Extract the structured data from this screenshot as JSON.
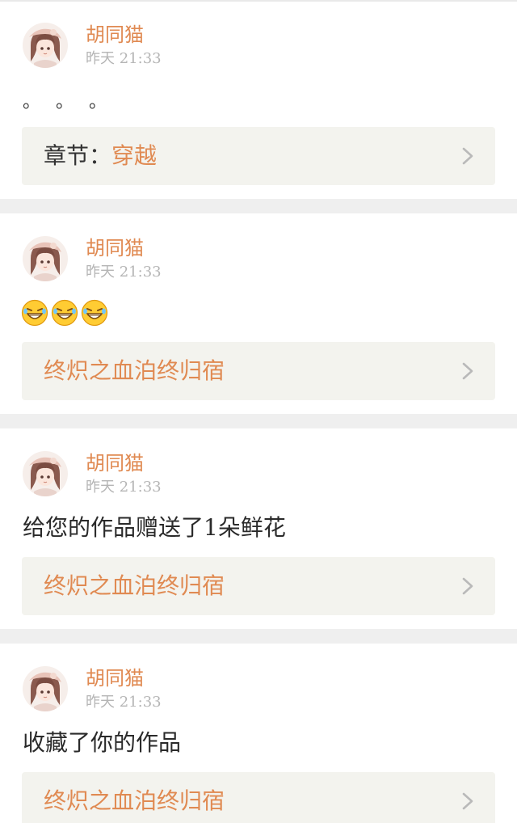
{
  "colors": {
    "accent": "#e08a52",
    "page_bg": "#efefef",
    "card_bg": "#ffffff",
    "link_box_bg": "#f3f3ee",
    "timestamp": "#b5b5b5",
    "body_text": "#2a2a2a"
  },
  "feed": [
    {
      "username": "胡同猫",
      "timestamp": "昨天 21:33",
      "content": "。 。 。",
      "link_prefix": "章节：",
      "link_value": "穿越",
      "avatar_icon": "anime-girl-avatar",
      "link_icon": "chevron-right-icon"
    },
    {
      "username": "胡同猫",
      "timestamp": "昨天 21:33",
      "emoji_icons": [
        "laughing-tears-emoji",
        "laughing-tears-emoji",
        "laughing-tears-emoji"
      ],
      "link_value": "终炽之血泊终归宿",
      "avatar_icon": "anime-girl-avatar",
      "link_icon": "chevron-right-icon"
    },
    {
      "username": "胡同猫",
      "timestamp": "昨天 21:33",
      "content": "给您的作品赠送了1朵鲜花",
      "link_value": "终炽之血泊终归宿",
      "avatar_icon": "anime-girl-avatar",
      "link_icon": "chevron-right-icon"
    },
    {
      "username": "胡同猫",
      "timestamp": "昨天 21:33",
      "content": "收藏了你的作品",
      "link_value": "终炽之血泊终归宿",
      "avatar_icon": "anime-girl-avatar",
      "link_icon": "chevron-right-icon"
    }
  ]
}
